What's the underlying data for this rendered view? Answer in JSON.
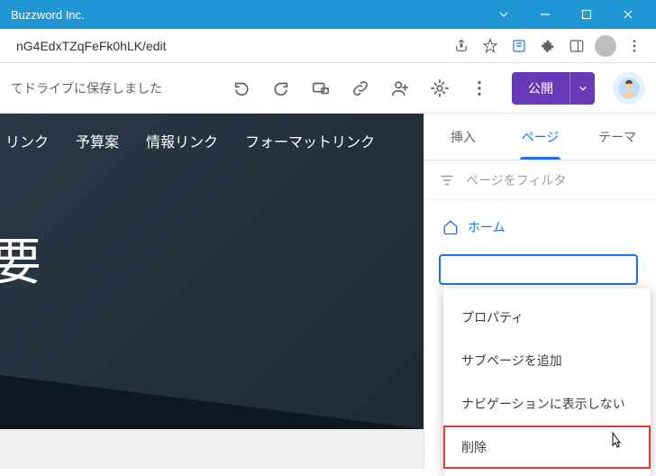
{
  "window": {
    "title": "Buzzword Inc."
  },
  "url": "nG4EdxTZqFeFk0hLK/edit",
  "toolbar": {
    "status": "てドライブに保存しました",
    "publish": "公開"
  },
  "canvas": {
    "nav": [
      "リンク",
      "予算案",
      "情報リンク",
      "フォーマットリンク"
    ],
    "title": "要"
  },
  "sidebar": {
    "tabs": [
      "挿入",
      "ページ",
      "テーマ"
    ],
    "filter_placeholder": "ページをフィルタ",
    "pages": [
      {
        "label": "ホーム"
      }
    ]
  },
  "context_menu": {
    "items": [
      "プロパティ",
      "サブページを追加",
      "ナビゲーションに表示しない",
      "削除"
    ]
  }
}
